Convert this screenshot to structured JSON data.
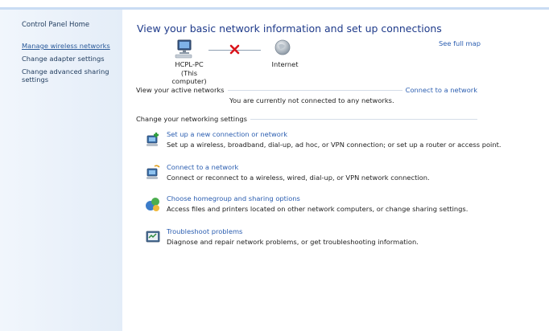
{
  "sidebar": {
    "home": "Control Panel Home",
    "links": [
      "Manage wireless networks",
      "Change adapter settings",
      "Change advanced sharing settings"
    ]
  },
  "main": {
    "title": "View your basic network information and set up connections",
    "see_full_map": "See full map",
    "map": {
      "computer_name": "HCPL-PC",
      "computer_sub": "(This computer)",
      "internet_label": "Internet"
    },
    "active_networks_label": "View your active networks",
    "connect_link": "Connect to a network",
    "not_connected": "You are currently not connected to any networks.",
    "change_settings_label": "Change your networking settings",
    "tasks": [
      {
        "icon": "new-connection-icon",
        "label": "Set up a new connection or network",
        "desc": "Set up a wireless, broadband, dial-up, ad hoc, or VPN connection; or set up a router or access point."
      },
      {
        "icon": "connect-network-icon",
        "label": "Connect to a network",
        "desc": "Connect or reconnect to a wireless, wired, dial-up, or VPN network connection."
      },
      {
        "icon": "homegroup-icon",
        "label": "Choose homegroup and sharing options",
        "desc": "Access files and printers located on other network computers, or change sharing settings."
      },
      {
        "icon": "troubleshoot-icon",
        "label": "Troubleshoot problems",
        "desc": "Diagnose and repair network problems, or get troubleshooting information."
      }
    ]
  },
  "colors": {
    "link": "#2a5db0",
    "title": "#1e3a8a",
    "sidebar": "#e8f0fa",
    "error_x": "#d9141b"
  }
}
